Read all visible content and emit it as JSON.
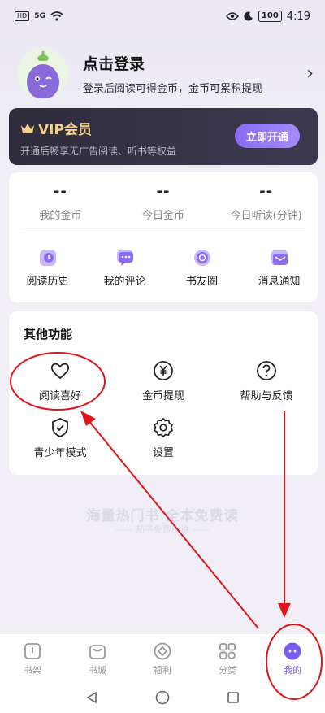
{
  "status_bar": {
    "hd": "HD",
    "network": "5G",
    "battery": "100",
    "time": "4:19"
  },
  "profile": {
    "title": "点击登录",
    "subtitle": "登录后阅读可得金币，金币可累积提现"
  },
  "vip": {
    "title": "VIP会员",
    "subtitle": "开通后畅享无广告阅读、听书等权益",
    "button": "立即开通"
  },
  "stats": [
    {
      "value": "--",
      "label": "我的金币"
    },
    {
      "value": "--",
      "label": "今日金币"
    },
    {
      "value": "--",
      "label": "今日听读(分钟)"
    }
  ],
  "shortcuts": [
    {
      "label": "阅读历史",
      "icon": "history-icon"
    },
    {
      "label": "我的评论",
      "icon": "comment-icon"
    },
    {
      "label": "书友圈",
      "icon": "circle-icon"
    },
    {
      "label": "消息通知",
      "icon": "mail-icon"
    }
  ],
  "other_functions": {
    "title": "其他功能",
    "items": [
      {
        "label": "阅读喜好",
        "icon": "heart-icon"
      },
      {
        "label": "金币提现",
        "icon": "yen-icon"
      },
      {
        "label": "帮助与反馈",
        "icon": "help-icon"
      },
      {
        "label": "青少年模式",
        "icon": "shield-icon"
      },
      {
        "label": "设置",
        "icon": "gear-icon"
      }
    ]
  },
  "slogan": {
    "main": "海量热门书 全本免费读",
    "sub": "—— 茄子免费小说 ——"
  },
  "tabs": [
    {
      "label": "书架",
      "icon": "bookshelf-icon"
    },
    {
      "label": "书城",
      "icon": "bookstore-icon"
    },
    {
      "label": "福利",
      "icon": "welfare-icon"
    },
    {
      "label": "分类",
      "icon": "category-icon"
    },
    {
      "label": "我的",
      "icon": "me-icon",
      "active": true
    }
  ],
  "colors": {
    "accent": "#7b5cf0",
    "vip_gold": "#f5d28c",
    "annotation_red": "#e0151b"
  }
}
